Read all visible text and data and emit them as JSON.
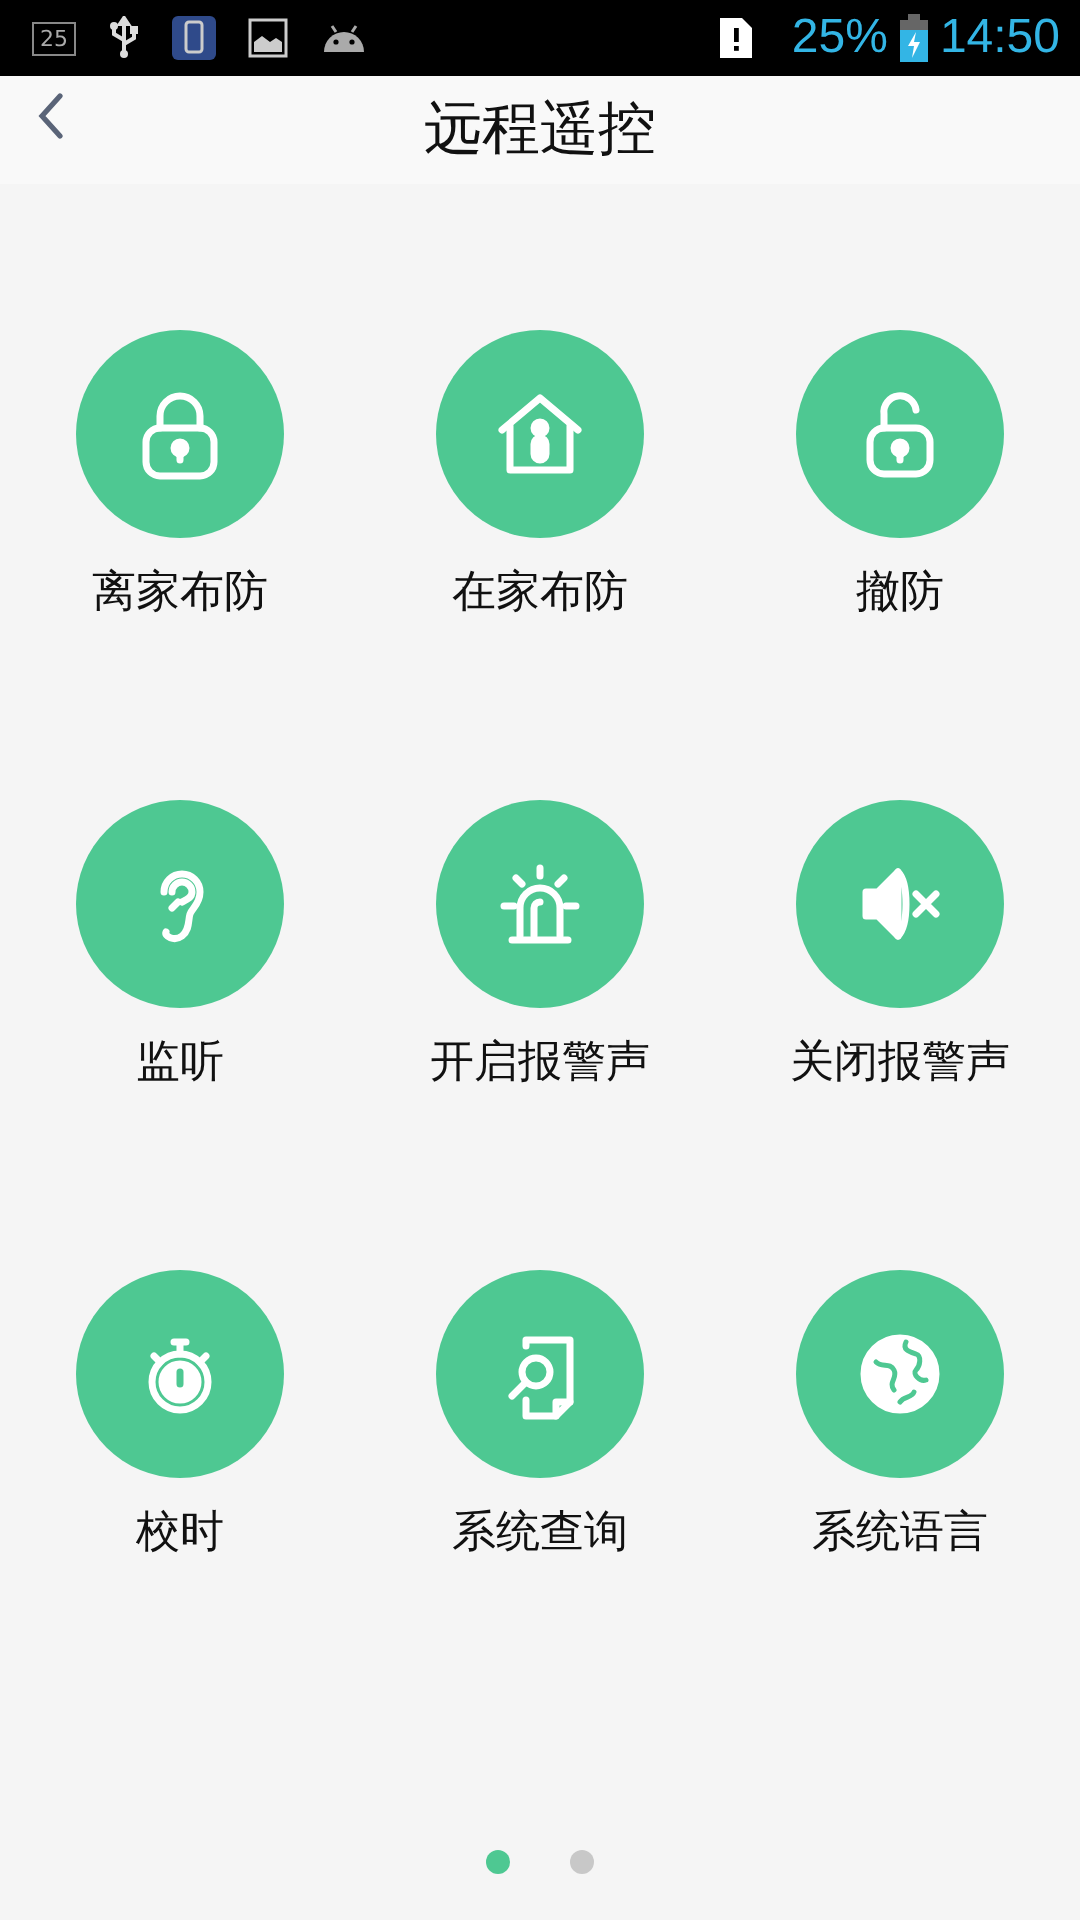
{
  "status_bar": {
    "notification_badge": "25",
    "battery_percent": "25%",
    "time": "14:50"
  },
  "header": {
    "title": "远程遥控"
  },
  "actions": [
    {
      "label": "离家布防",
      "kind": "lock"
    },
    {
      "label": "在家布防",
      "kind": "home"
    },
    {
      "label": "撤防",
      "kind": "unlock"
    },
    {
      "label": "监听",
      "kind": "ear"
    },
    {
      "label": "开启报警声",
      "kind": "alarm"
    },
    {
      "label": "关闭报警声",
      "kind": "mute"
    },
    {
      "label": "校时",
      "kind": "timer"
    },
    {
      "label": "系统查询",
      "kind": "query"
    },
    {
      "label": "系统语言",
      "kind": "globe"
    }
  ],
  "pager": [
    {
      "selected": true
    },
    {
      "selected": false
    }
  ]
}
